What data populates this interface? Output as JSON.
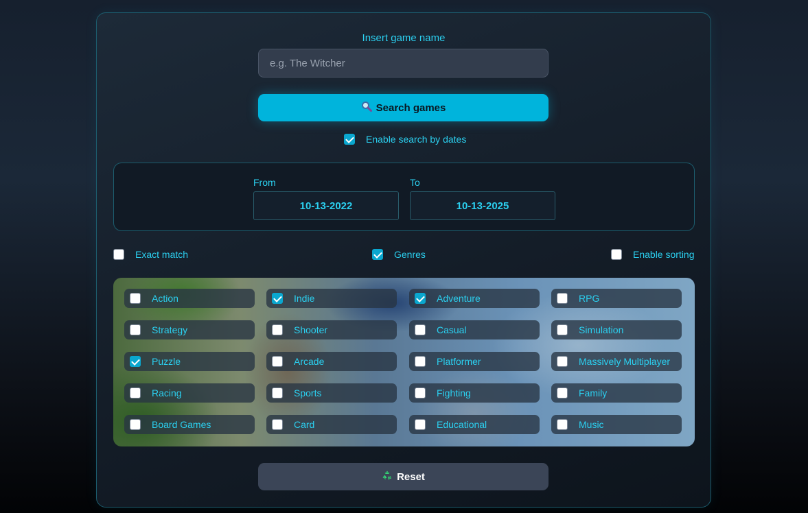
{
  "search": {
    "label": "Insert game name",
    "placeholder": "e.g. The Witcher",
    "value": "",
    "button_label": "Search games",
    "button_icon": "magnifier-icon"
  },
  "date_search": {
    "label": "Enable search by dates",
    "checked": true
  },
  "dates": {
    "from_label": "From",
    "from_value": "10-13-2022",
    "to_label": "To",
    "to_value": "10-13-2025"
  },
  "options": {
    "exact_match": {
      "label": "Exact match",
      "checked": false
    },
    "genres": {
      "label": "Genres",
      "checked": true
    },
    "sorting": {
      "label": "Enable sorting",
      "checked": false
    }
  },
  "genres": [
    {
      "label": "Action",
      "checked": false
    },
    {
      "label": "Indie",
      "checked": true
    },
    {
      "label": "Adventure",
      "checked": true
    },
    {
      "label": "RPG",
      "checked": false
    },
    {
      "label": "Strategy",
      "checked": false
    },
    {
      "label": "Shooter",
      "checked": false
    },
    {
      "label": "Casual",
      "checked": false
    },
    {
      "label": "Simulation",
      "checked": false
    },
    {
      "label": "Puzzle",
      "checked": true
    },
    {
      "label": "Arcade",
      "checked": false
    },
    {
      "label": "Platformer",
      "checked": false
    },
    {
      "label": "Massively Multiplayer",
      "checked": false
    },
    {
      "label": "Racing",
      "checked": false
    },
    {
      "label": "Sports",
      "checked": false
    },
    {
      "label": "Fighting",
      "checked": false
    },
    {
      "label": "Family",
      "checked": false
    },
    {
      "label": "Board Games",
      "checked": false
    },
    {
      "label": "Card",
      "checked": false
    },
    {
      "label": "Educational",
      "checked": false
    },
    {
      "label": "Music",
      "checked": false
    }
  ],
  "reset": {
    "label": "Reset",
    "icon": "recycle-icon"
  },
  "colors": {
    "accent": "#2bd0f0",
    "primary_button": "#00b4dc",
    "secondary_button": "#3b4557",
    "checkbox_checked": "#0aa7cf"
  }
}
